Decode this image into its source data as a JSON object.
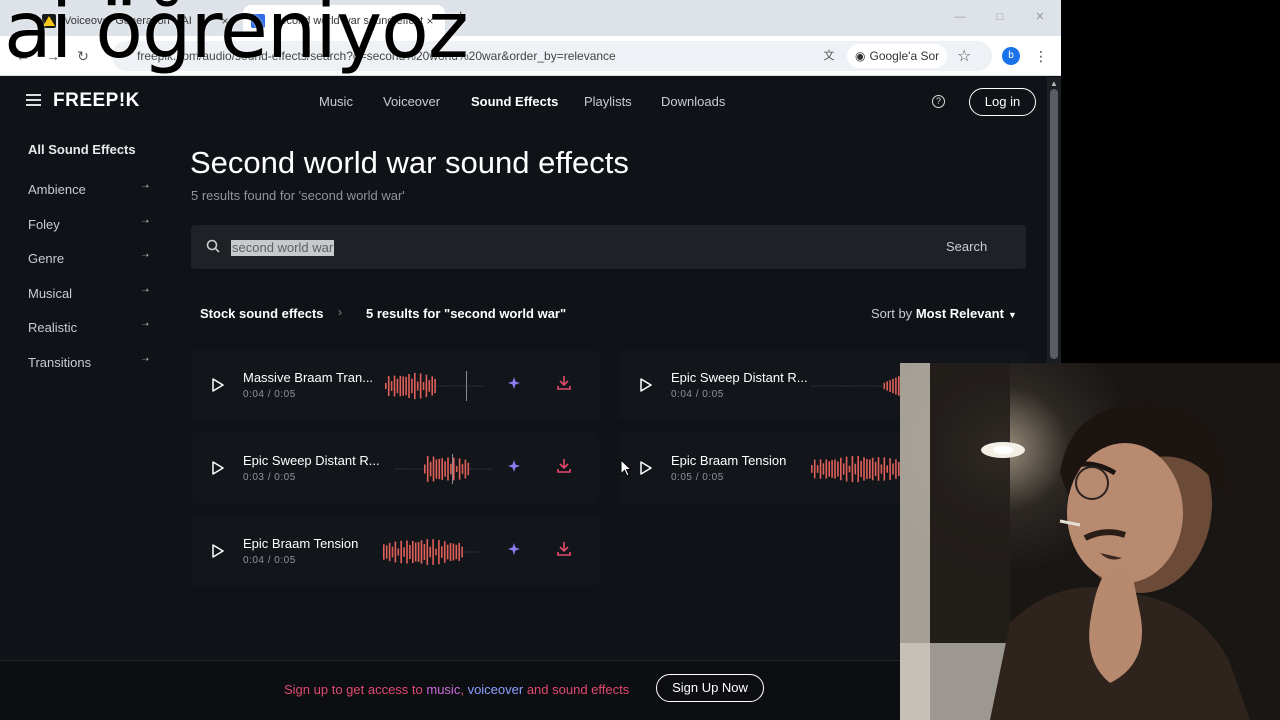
{
  "browser": {
    "tabs": [
      {
        "title": "Voiceover Generation – AI",
        "close": "×"
      },
      {
        "title": "Second world war sound effects",
        "close": "×"
      }
    ],
    "new_tab": "+",
    "url": "freepik.com/audio/sound-effects/search?q=second%20world%20war&order_by=relevance",
    "google_ask": "Google'a Sor",
    "profile_initial": "b"
  },
  "nav": {
    "logo": "FREEP!K",
    "items": [
      "Music",
      "Voiceover",
      "Sound Effects",
      "Playlists",
      "Downloads"
    ],
    "active": "Sound Effects",
    "login": "Log in",
    "help_icon": "?"
  },
  "sidebar": {
    "all": "All Sound Effects",
    "items": [
      "Ambience",
      "Foley",
      "Genre",
      "Musical",
      "Realistic",
      "Transitions"
    ]
  },
  "main": {
    "title": "Second world war sound effects",
    "subtitle": "5 results found for 'second world war'",
    "search_value": "second world war",
    "search_button": "Search",
    "breadcrumb_root": "Stock sound effects",
    "breadcrumb_current": "5 results for \"second world war\"",
    "sort_label": "Sort by",
    "sort_value": "Most Relevant"
  },
  "results": [
    {
      "title": "Massive Braam Tran...",
      "time": "0:04 / 0:05"
    },
    {
      "title": "Epic Sweep Distant R...",
      "time": "0:04 / 0:05"
    },
    {
      "title": "Epic Sweep Distant R...",
      "time": "0:03 / 0:05"
    },
    {
      "title": "Epic Braam Tension",
      "time": "0:05 / 0:05"
    },
    {
      "title": "Epic Braam Tension",
      "time": "0:04 / 0:05"
    }
  ],
  "signup": {
    "text_start": "Sign up to get access to ",
    "music": "music",
    "comma": ", ",
    "voiceover": "voiceover",
    "and": " and ",
    "sfx": "sound effects",
    "button": "Sign Up Now"
  },
  "overlay_caption": "ai öğreniyoz",
  "colors": {
    "accent_red": "#e04a6e",
    "waveform": "#e0605a",
    "ai_purple": "#8f7cf5",
    "bg": "#0f1216"
  }
}
